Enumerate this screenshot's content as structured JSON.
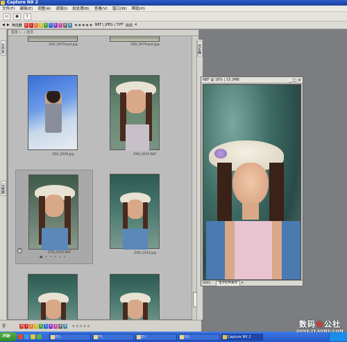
{
  "app": {
    "title": "Capture NX 2"
  },
  "menu": [
    "文件(F)",
    "编辑(E)",
    "调整(A)",
    "滤镜(I)",
    "批处理(B)",
    "查看(V)",
    "窗口(W)",
    "帮助(H)"
  ],
  "filter": {
    "label": "筛选器",
    "label_badges": [
      "0",
      "1",
      "2",
      "3",
      "4",
      "5",
      "6",
      "7",
      "8",
      "9"
    ],
    "badge_colors": [
      "#d23b2a",
      "#cc2b2b",
      "#e07a2a",
      "#d4b82a",
      "#3e9a3a",
      "#2b6ad0",
      "#7a3ac8",
      "#d048a8",
      "#6a6a6a",
      "#4a8aaa"
    ],
    "stars": "★★★★★",
    "formats": "NEF | JPEG | TIFF",
    "sort": "如前",
    "count": "4"
  },
  "left_tabs": [
    "文件夹",
    "元数据"
  ],
  "right_tabs": [
    "浏览器"
  ],
  "browser": {
    "header": "图像 (...)  选项",
    "thumbs": [
      {
        "name": "ZD2_0475spot.jpg",
        "selected": false
      },
      {
        "name": "ZD2_0476spot.jpg",
        "selected": false
      },
      {
        "name": "ZD2_0500.jpg",
        "selected": false
      },
      {
        "name": "ZXD_0252.NEF",
        "selected": false
      },
      {
        "name": "ZXD_0253.NEF",
        "selected": true
      },
      {
        "name": "ZXD_0254.jpg",
        "selected": false
      },
      {
        "name": "",
        "selected": false
      },
      {
        "name": "",
        "selected": false
      }
    ],
    "rating_dots": "● • • • • •",
    "thumb_badge": "0"
  },
  "viewer": {
    "title": "NEF @ 16% | 15.3MB",
    "footer_left": "0001",
    "footer_tab": "电子控件关闭"
  },
  "taskbar": {
    "start": "开始",
    "tasks": [
      "D:\\",
      "F:\\",
      "E:\\",
      "G:\\",
      "Capture NX 2"
    ],
    "quick_colors": [
      "#e24a2a",
      "#3a9ae2",
      "#e6c23a",
      "#5ab04a",
      "#3a6ad0"
    ]
  },
  "watermark": {
    "line1": "数码",
    "star": "★",
    "line1b": "公社",
    "line2": "ZONE.IT.SOHU.COM"
  },
  "colors": {
    "title_bg": "#1b3fa0",
    "panel_bg": "#bcbcbc",
    "workspace": "#7b7d80"
  }
}
